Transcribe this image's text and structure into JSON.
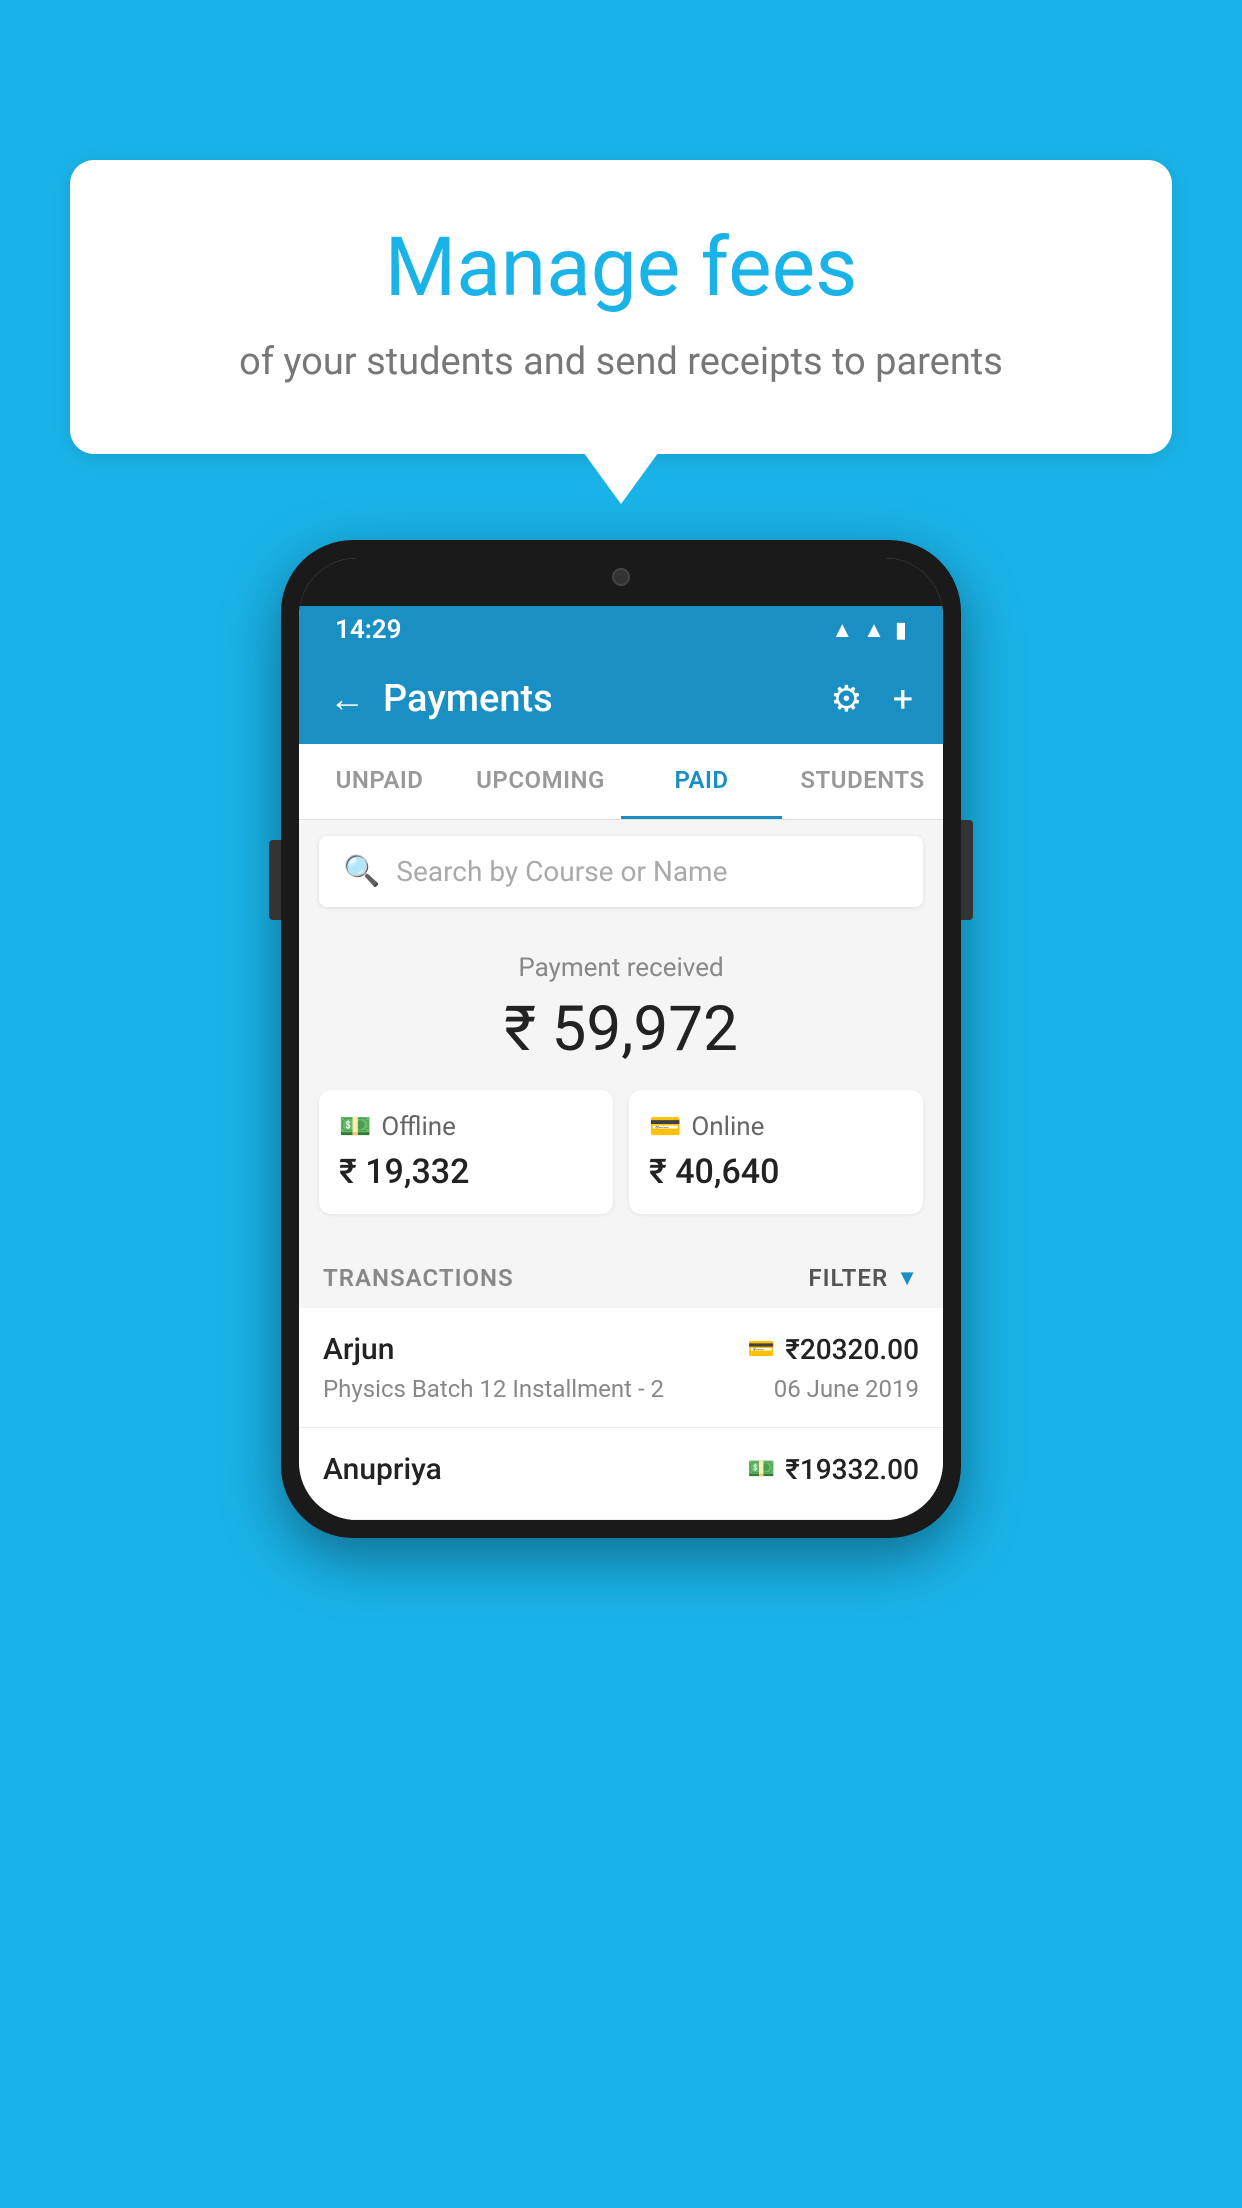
{
  "background_color": "#1ab3e8",
  "speech_bubble": {
    "title": "Manage fees",
    "subtitle": "of your students and send receipts to parents"
  },
  "status_bar": {
    "time": "14:29",
    "icons": [
      "wifi",
      "signal",
      "battery"
    ]
  },
  "app_bar": {
    "title": "Payments",
    "back_label": "←",
    "settings_label": "⚙",
    "add_label": "+"
  },
  "tabs": [
    {
      "label": "UNPAID",
      "active": false
    },
    {
      "label": "UPCOMING",
      "active": false
    },
    {
      "label": "PAID",
      "active": true
    },
    {
      "label": "STUDENTS",
      "active": false
    }
  ],
  "search": {
    "placeholder": "Search by Course or Name"
  },
  "payment_summary": {
    "received_label": "Payment received",
    "total_amount": "₹ 59,972",
    "offline_label": "Offline",
    "offline_amount": "₹ 19,332",
    "online_label": "Online",
    "online_amount": "₹ 40,640"
  },
  "transactions_section": {
    "label": "TRANSACTIONS",
    "filter_label": "FILTER"
  },
  "transactions": [
    {
      "name": "Arjun",
      "detail": "Physics Batch 12 Installment - 2",
      "amount": "₹20320.00",
      "date": "06 June 2019",
      "payment_type": "card"
    },
    {
      "name": "Anupriya",
      "detail": "",
      "amount": "₹19332.00",
      "date": "",
      "payment_type": "cash"
    }
  ]
}
